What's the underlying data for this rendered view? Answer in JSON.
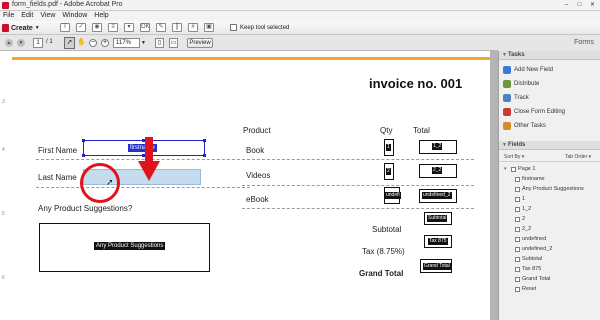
{
  "window": {
    "title": "form_fields.pdf - Adobe Acrobat Pro",
    "controls": [
      "–",
      "□",
      "✕"
    ]
  },
  "menu": [
    "File",
    "Edit",
    "View",
    "Window",
    "Help"
  ],
  "toolbar": {
    "create_label": "Create",
    "keep_tool_label": "Keep tool selected",
    "page_current": "1",
    "page_total": "/ 1",
    "zoom_value": "117%",
    "preview_label": "Preview"
  },
  "forms_header": "Forms",
  "document": {
    "invoice_title": "invoice no. 001",
    "labels": {
      "first_name": "First Name",
      "last_name": "Last Name",
      "suggestions": "Any Product Suggestions?",
      "product": "Product",
      "qty": "Qty",
      "total": "Total",
      "book": "Book",
      "videos": "Videos",
      "ebook": "eBook",
      "subtotal": "Subtotal",
      "tax": "Tax (8.75%)",
      "grand_total": "Grand Total"
    },
    "fields": {
      "firstname": "firstname",
      "suggestions": "Any Product Suggestions",
      "qty1": "1",
      "qty2": "2",
      "qty3": "undefi",
      "tot1": "1_2",
      "tot2": "2_2",
      "tot3": "undefined_2",
      "subtotal": "Subtotal",
      "tax": "Tax 875",
      "grand": "Grand Total"
    }
  },
  "panel": {
    "tasks_header": "Tasks",
    "tasks": [
      {
        "label": "Add New Field",
        "color": "#3a7bd5"
      },
      {
        "label": "Distribute",
        "color": "#6c9a3a"
      },
      {
        "label": "Track",
        "color": "#4a82c2"
      },
      {
        "label": "Close Form Editing",
        "color": "#cc3b30"
      },
      {
        "label": "Other Tasks",
        "color": "#d88a2b"
      }
    ],
    "fields_header": "Fields",
    "sort_by": "Sort By ▾",
    "tab_order": "Tab Order ▾",
    "tree_root": "Page 1",
    "tree": [
      "firstname",
      "Any Product Suggestions",
      "1",
      "1_2",
      "2",
      "2_2",
      "undefined",
      "undefined_2",
      "Subtotal",
      "Tax 875",
      "Grand Total",
      "Reset"
    ]
  },
  "colors": {
    "accent_orange": "#f5a623",
    "selection_blue": "#2222c8",
    "annotation_red": "#e0121b"
  }
}
